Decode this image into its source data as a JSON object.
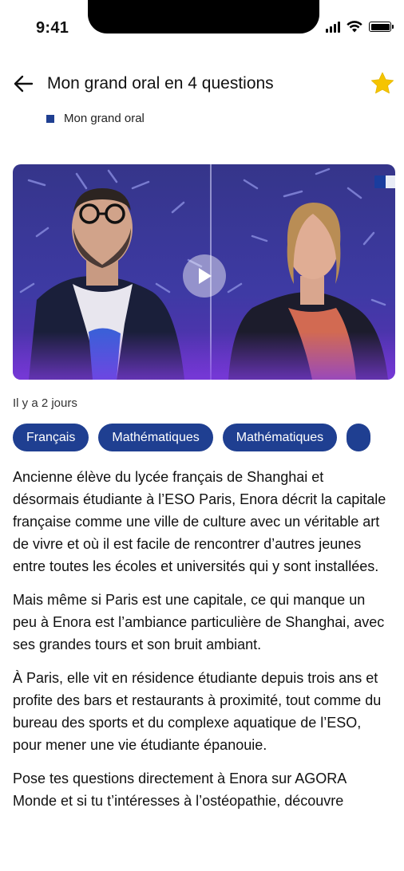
{
  "status_bar": {
    "time": "9:41"
  },
  "header": {
    "title": "Mon grand oral en 4 questions"
  },
  "category": {
    "label": "Mon grand oral"
  },
  "video": {
    "accent": "#3e3aa4"
  },
  "meta": {
    "date": "Il y a 2 jours"
  },
  "tags": [
    "Français",
    "Mathématiques",
    "Mathématiques"
  ],
  "paragraphs": [
    "Ancienne élève du lycée français de Shanghai et désormais étudiante à l’ESO Paris, Enora décrit la capitale française comme une ville de culture avec un véritable art de vivre et où il est facile de rencontrer d’autres jeunes entre toutes les écoles et universités qui y sont installées.",
    "Mais même si Paris est une capitale, ce qui manque un peu à Enora est l’ambiance particulière de Shanghai, avec ses grandes tours et son bruit ambiant.",
    "À Paris, elle vit en résidence étudiante depuis trois ans et profite des bars et restaurants à proximité, tout comme du bureau des sports et du complexe aquatique de l’ESO, pour mener une vie étudiante épanouie.",
    "Pose tes questions directement à Enora sur AGORA Monde et si tu t’intéresses à l’ostéopathie, découvre"
  ],
  "colors": {
    "brand": "#1f3f91",
    "star": "#f5c400"
  }
}
